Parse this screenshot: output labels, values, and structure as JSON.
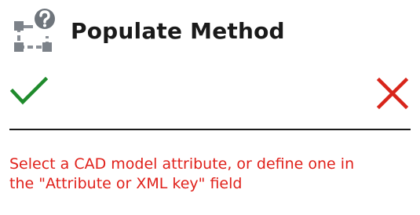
{
  "header": {
    "icon": "populate-method-icon",
    "title": "Populate Method"
  },
  "actions": {
    "confirm_icon": "checkmark-icon",
    "confirm_color": "#1f8b2c",
    "cancel_icon": "close-icon",
    "cancel_color": "#d8251b"
  },
  "message": {
    "text": "Select a CAD model attribute, or define one in\nthe \"Attribute or XML key\" field",
    "color": "#e0211b"
  }
}
